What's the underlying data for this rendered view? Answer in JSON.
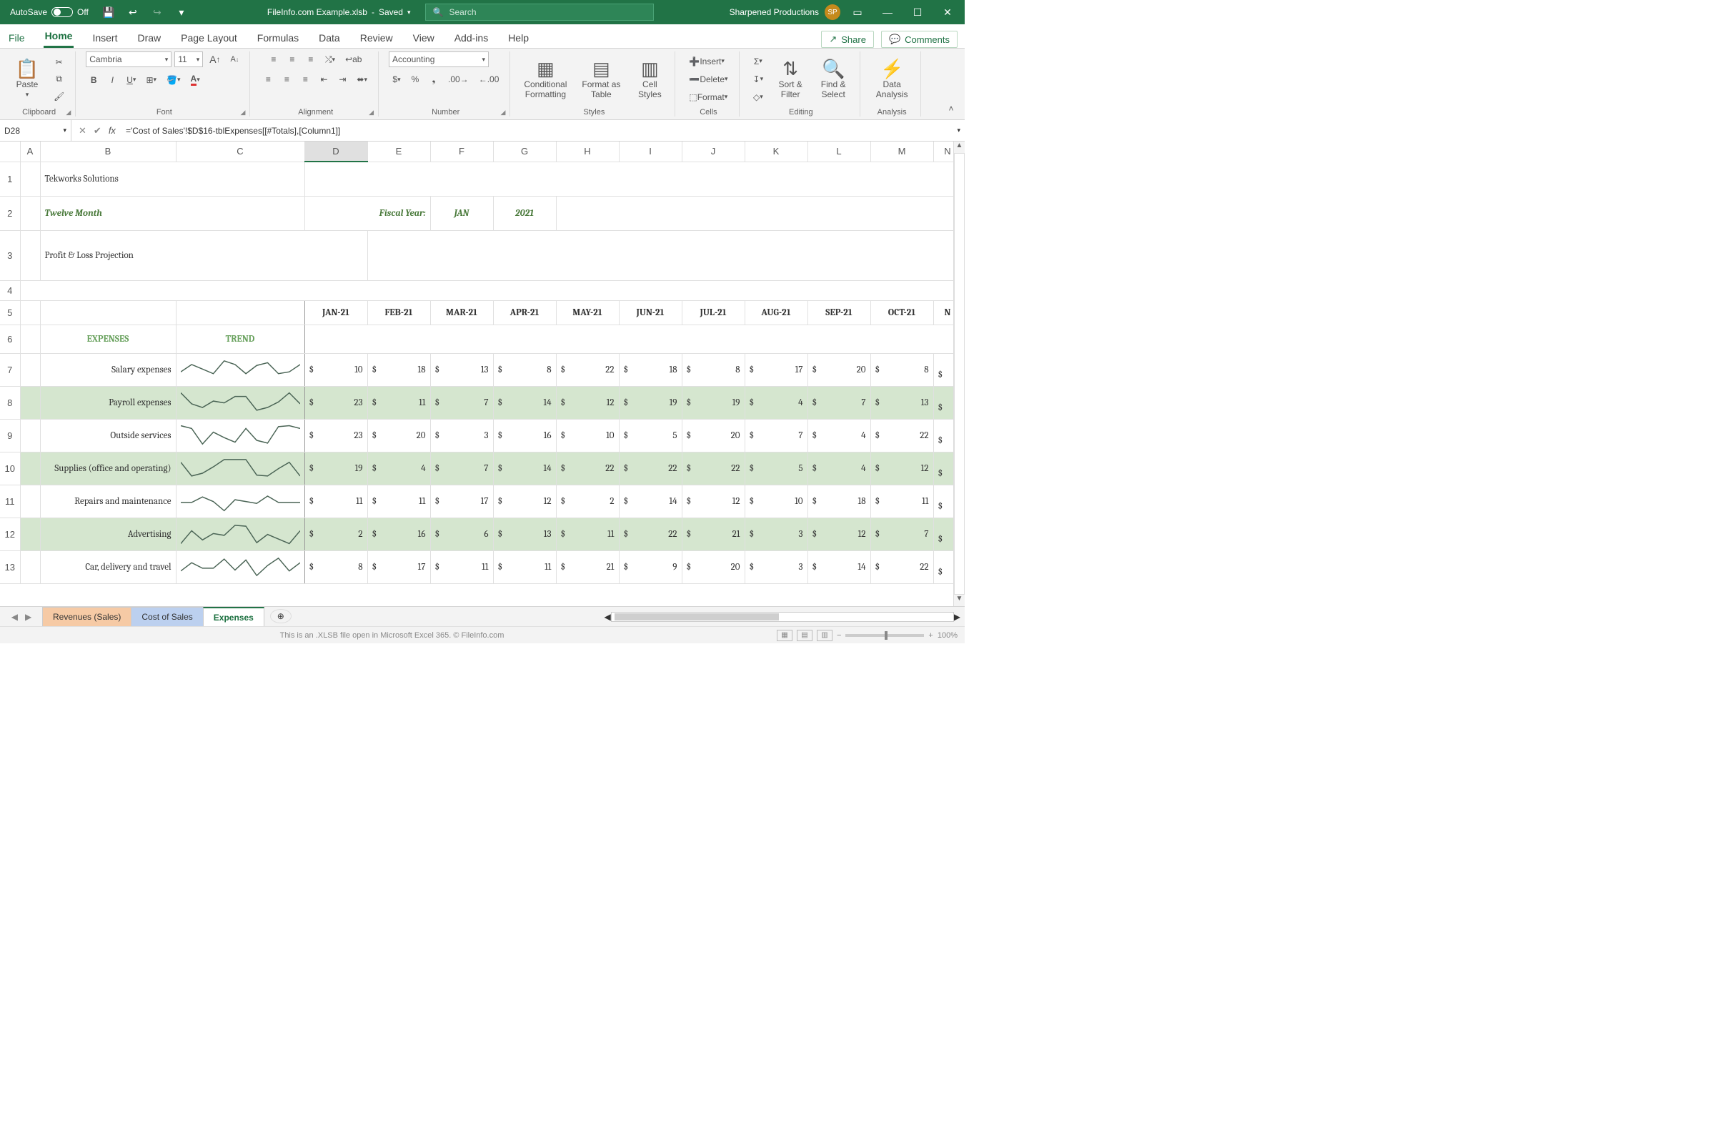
{
  "titlebar": {
    "autosave_label": "AutoSave",
    "autosave_state": "Off",
    "document": "FileInfo.com Example.xlsb",
    "save_state": "Saved",
    "search_placeholder": "Search",
    "account": "Sharpened Productions",
    "account_initials": "SP"
  },
  "tabs": {
    "file": "File",
    "items": [
      "Home",
      "Insert",
      "Draw",
      "Page Layout",
      "Formulas",
      "Data",
      "Review",
      "View",
      "Add-ins",
      "Help"
    ],
    "active": "Home",
    "share": "Share",
    "comments": "Comments"
  },
  "ribbon": {
    "clipboard": {
      "paste": "Paste",
      "label": "Clipboard"
    },
    "font": {
      "name": "Cambria",
      "size": "11",
      "label": "Font"
    },
    "alignment": {
      "label": "Alignment"
    },
    "number": {
      "format": "Accounting",
      "label": "Number"
    },
    "styles": {
      "conditional": "Conditional Formatting",
      "table": "Format as Table",
      "cell": "Cell Styles",
      "label": "Styles"
    },
    "cells": {
      "insert": "Insert",
      "delete": "Delete",
      "format": "Format",
      "label": "Cells"
    },
    "editing": {
      "sort": "Sort & Filter",
      "find": "Find & Select",
      "label": "Editing"
    },
    "analysis": {
      "data": "Data Analysis",
      "label": "Analysis"
    }
  },
  "formula_bar": {
    "name_box": "D28",
    "formula": "='Cost of Sales'!$D$16-tblExpenses[[#Totals],[Column1]]"
  },
  "columns": [
    "A",
    "B",
    "C",
    "D",
    "E",
    "F",
    "G",
    "H",
    "I",
    "J",
    "K",
    "L",
    "M",
    "N"
  ],
  "rows_visible": [
    "1",
    "2",
    "3",
    "4",
    "5",
    "6",
    "7",
    "8",
    "9",
    "10",
    "11",
    "12"
  ],
  "sheet": {
    "company": "Tekworks Solutions",
    "subtitle": "Twelve Month",
    "fiscal_label": "Fiscal Year:",
    "fiscal_month": "JAN",
    "fiscal_year": "2021",
    "section": "Profit & Loss Projection",
    "expenses_hdr": "EXPENSES",
    "trend_hdr": "TREND",
    "months": [
      "JAN-21",
      "FEB-21",
      "MAR-21",
      "APR-21",
      "MAY-21",
      "JUN-21",
      "JUL-21",
      "AUG-21",
      "SEP-21",
      "OCT-21"
    ],
    "rows": [
      {
        "label": "Salary expenses",
        "vals": [
          10,
          18,
          13,
          8,
          22,
          18,
          8,
          17,
          20,
          8
        ]
      },
      {
        "label": "Payroll expenses",
        "vals": [
          23,
          11,
          7,
          14,
          12,
          19,
          19,
          4,
          7,
          13
        ]
      },
      {
        "label": "Outside services",
        "vals": [
          23,
          20,
          3,
          16,
          10,
          5,
          20,
          7,
          4,
          22
        ]
      },
      {
        "label": "Supplies (office and operating)",
        "vals": [
          19,
          4,
          7,
          14,
          22,
          22,
          22,
          5,
          4,
          12
        ]
      },
      {
        "label": "Repairs and maintenance",
        "vals": [
          11,
          11,
          17,
          12,
          2,
          14,
          12,
          10,
          18,
          11
        ]
      },
      {
        "label": "Advertising",
        "vals": [
          2,
          16,
          6,
          13,
          11,
          22,
          21,
          3,
          12,
          7
        ]
      },
      {
        "label": "Car, delivery and travel",
        "vals": [
          8,
          17,
          11,
          11,
          21,
          9,
          20,
          3,
          14,
          22
        ]
      }
    ]
  },
  "sheet_tabs": {
    "revenues": "Revenues (Sales)",
    "cost": "Cost of Sales",
    "expenses": "Expenses"
  },
  "statusbar": {
    "info": "This is an .XLSB file open in Microsoft Excel 365. © FileInfo.com",
    "zoom": "100%"
  },
  "chart_data": {
    "type": "table",
    "title": "Profit & Loss Projection — Expenses",
    "columns": [
      "JAN-21",
      "FEB-21",
      "MAR-21",
      "APR-21",
      "MAY-21",
      "JUN-21",
      "JUL-21",
      "AUG-21",
      "SEP-21",
      "OCT-21"
    ],
    "series": [
      {
        "name": "Salary expenses",
        "values": [
          10,
          18,
          13,
          8,
          22,
          18,
          8,
          17,
          20,
          8
        ]
      },
      {
        "name": "Payroll expenses",
        "values": [
          23,
          11,
          7,
          14,
          12,
          19,
          19,
          4,
          7,
          13
        ]
      },
      {
        "name": "Outside services",
        "values": [
          23,
          20,
          3,
          16,
          10,
          5,
          20,
          7,
          4,
          22
        ]
      },
      {
        "name": "Supplies (office and operating)",
        "values": [
          19,
          4,
          7,
          14,
          22,
          22,
          22,
          5,
          4,
          12
        ]
      },
      {
        "name": "Repairs and maintenance",
        "values": [
          11,
          11,
          17,
          12,
          2,
          14,
          12,
          10,
          18,
          11
        ]
      },
      {
        "name": "Advertising",
        "values": [
          2,
          16,
          6,
          13,
          11,
          22,
          21,
          3,
          12,
          7
        ]
      },
      {
        "name": "Car, delivery and travel",
        "values": [
          8,
          17,
          11,
          11,
          21,
          9,
          20,
          3,
          14,
          22
        ]
      }
    ]
  }
}
